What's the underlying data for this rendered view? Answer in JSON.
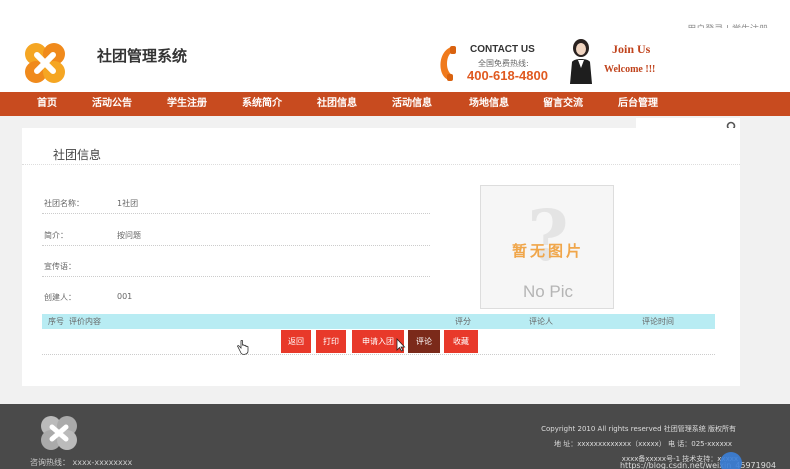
{
  "top_links": "用户登录 | 学生注册",
  "header": {
    "site_title": "社团管理系统",
    "contact_title": "CONTACT US",
    "contact_sub": "全国免费热线:",
    "contact_phone": "400-618-4800",
    "join_us": "Join Us",
    "welcome": "Welcome !!!"
  },
  "nav": {
    "items": [
      {
        "label": "首页"
      },
      {
        "label": "活动公告"
      },
      {
        "label": "学生注册"
      },
      {
        "label": "系统简介"
      },
      {
        "label": "社团信息"
      },
      {
        "label": "活动信息"
      },
      {
        "label": "场地信息"
      },
      {
        "label": "留言交流"
      },
      {
        "label": "后台管理"
      }
    ]
  },
  "section": {
    "title": "社团信息"
  },
  "fields": [
    {
      "label": "社团名称：",
      "value": "1社团"
    },
    {
      "label": "简介：",
      "value": "按问题"
    },
    {
      "label": "宣传语：",
      "value": ""
    },
    {
      "label": "创建人：",
      "value": "001"
    }
  ],
  "no_pic": {
    "question": "?",
    "cn": "暂无图片",
    "en": "No Pic"
  },
  "table": {
    "headers": [
      "序号",
      "评价内容",
      "评分",
      "评论人",
      "评论时间"
    ]
  },
  "buttons": {
    "back": "返回",
    "print": "打印",
    "apply": "申请入团",
    "comment": "评论",
    "favorite": "收藏"
  },
  "footer": {
    "hotline": "咨询热线： xxxx-xxxxxxxx",
    "copyright": "Copyright 2010 All rights reserved 社团管理系统 版权所有",
    "address": "地  址：xxxxxxxxxxxxx（xxxxx） 电  话：025-xxxxxx",
    "record": "xxxx备xxxxx号-1 技术支持：xxxxx",
    "watermark": "https://blog.csdn.net/weixin_45971904"
  },
  "colors": {
    "nav_bg": "#c84b1f",
    "btn_red": "#e8392a",
    "btn_dark": "#7b2a1a",
    "table_head": "#b8ecf3",
    "footer_bg": "#4a4a4a"
  }
}
